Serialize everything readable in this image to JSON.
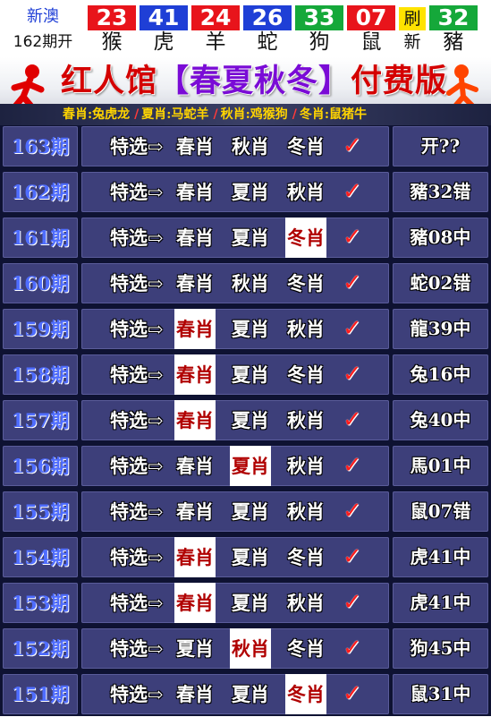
{
  "header": {
    "source": "新澳",
    "period": "162期开",
    "balls": [
      {
        "number": "23",
        "zodiac": "猴",
        "color": "#e8141b"
      },
      {
        "number": "41",
        "zodiac": "虎",
        "color": "#1f3fd6"
      },
      {
        "number": "24",
        "zodiac": "羊",
        "color": "#e8141b"
      },
      {
        "number": "26",
        "zodiac": "蛇",
        "color": "#1f3fd6"
      },
      {
        "number": "33",
        "zodiac": "狗",
        "color": "#15a83a"
      },
      {
        "number": "07",
        "zodiac": "鼠",
        "color": "#e8141b"
      }
    ],
    "special_sep_top": "刷",
    "special_sep_bottom": "新",
    "special_ball": {
      "number": "32",
      "zodiac": "豬",
      "color": "#15a83a"
    }
  },
  "banner": {
    "title_part1": "红人馆",
    "title_part2": "【春夏秋冬】",
    "title_part3": "付费版",
    "seasons": [
      "春肖:兔虎龙",
      "夏肖:马蛇羊",
      "秋肖:鸡猴狗",
      "冬肖:鼠猪牛"
    ],
    "divider": "/"
  },
  "rows": [
    {
      "period": "163期",
      "label": "特选⇨",
      "seasons": [
        "春肖",
        "秋肖",
        "冬肖"
      ],
      "hit": -1,
      "check": "✓",
      "result": "开??"
    },
    {
      "period": "162期",
      "label": "特选⇨",
      "seasons": [
        "春肖",
        "夏肖",
        "秋肖"
      ],
      "hit": -1,
      "check": "✓",
      "result": "豬32错"
    },
    {
      "period": "161期",
      "label": "特选⇨",
      "seasons": [
        "春肖",
        "夏肖",
        "冬肖"
      ],
      "hit": 2,
      "check": "✓",
      "result": "豬08中"
    },
    {
      "period": "160期",
      "label": "特选⇨",
      "seasons": [
        "春肖",
        "秋肖",
        "冬肖"
      ],
      "hit": -1,
      "check": "✓",
      "result": "蛇02错"
    },
    {
      "period": "159期",
      "label": "特选⇨",
      "seasons": [
        "春肖",
        "夏肖",
        "秋肖"
      ],
      "hit": 0,
      "check": "✓",
      "result": "龍39中"
    },
    {
      "period": "158期",
      "label": "特选⇨",
      "seasons": [
        "春肖",
        "夏肖",
        "冬肖"
      ],
      "hit": 0,
      "check": "✓",
      "result": "兔16中"
    },
    {
      "period": "157期",
      "label": "特选⇨",
      "seasons": [
        "春肖",
        "夏肖",
        "秋肖"
      ],
      "hit": 0,
      "check": "✓",
      "result": "兔40中"
    },
    {
      "period": "156期",
      "label": "特选⇨",
      "seasons": [
        "春肖",
        "夏肖",
        "秋肖"
      ],
      "hit": 1,
      "check": "✓",
      "result": "馬01中"
    },
    {
      "period": "155期",
      "label": "特选⇨",
      "seasons": [
        "春肖",
        "夏肖",
        "秋肖"
      ],
      "hit": -1,
      "check": "✓",
      "result": "鼠07错"
    },
    {
      "period": "154期",
      "label": "特选⇨",
      "seasons": [
        "春肖",
        "夏肖",
        "冬肖"
      ],
      "hit": 0,
      "check": "✓",
      "result": "虎41中"
    },
    {
      "period": "153期",
      "label": "特选⇨",
      "seasons": [
        "春肖",
        "夏肖",
        "秋肖"
      ],
      "hit": 0,
      "check": "✓",
      "result": "虎41中"
    },
    {
      "period": "152期",
      "label": "特选⇨",
      "seasons": [
        "夏肖",
        "秋肖",
        "冬肖"
      ],
      "hit": 1,
      "check": "✓",
      "result": "狗45中"
    },
    {
      "period": "151期",
      "label": "特选⇨",
      "seasons": [
        "春肖",
        "夏肖",
        "冬肖"
      ],
      "hit": 2,
      "check": "✓",
      "result": "鼠31中"
    }
  ]
}
